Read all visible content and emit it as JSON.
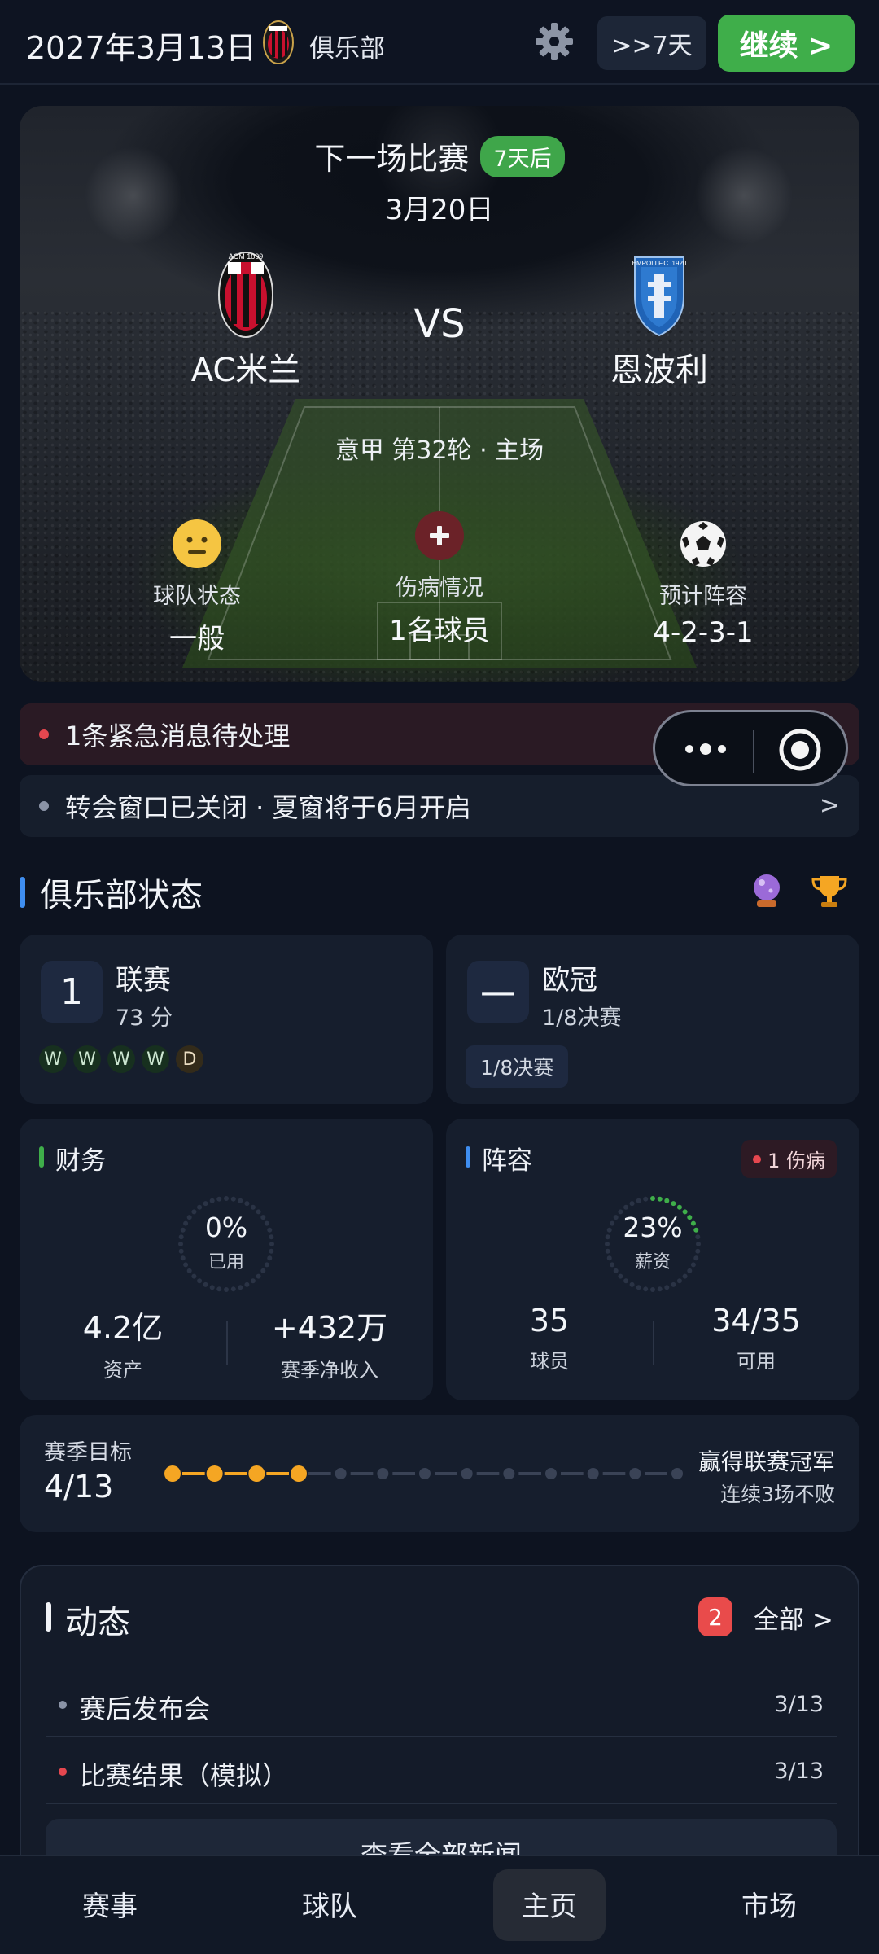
{
  "topbar": {
    "date": "2027年3月13日",
    "club_label": "俱乐部",
    "skip_label": ">>7天",
    "continue_label": "继续 >"
  },
  "match": {
    "title": "下一场比赛",
    "countdown_badge": "7天后",
    "date": "3月20日",
    "home_team": "AC米兰",
    "away_team": "恩波利",
    "vs": "VS",
    "competition": "意甲 第32轮 · 主场",
    "stats": [
      {
        "label": "球队状态",
        "value": "一般",
        "icon": "neutral-face-icon"
      },
      {
        "label": "伤病情况",
        "value": "1名球员",
        "icon": "medical-cross-icon"
      },
      {
        "label": "预计阵容",
        "value": "4-2-3-1",
        "icon": "soccer-ball-icon"
      }
    ],
    "home_crest_text": "ACM 1899",
    "away_crest_text": "EMPOLI F.C. 1920"
  },
  "notices": {
    "urgent": "1条紧急消息待处理",
    "transfer": "转会窗口已关闭 · 夏窗将于6月开启",
    "arrow": ">"
  },
  "club_status": {
    "title": "俱乐部状态",
    "league": {
      "rank": "1",
      "title": "联赛",
      "points": "73 分",
      "form": [
        "W",
        "W",
        "W",
        "W",
        "D"
      ]
    },
    "cup": {
      "rank": "—",
      "title": "欧冠",
      "stage": "1/8决赛",
      "tag": "1/8决赛"
    },
    "finance": {
      "title": "财务",
      "ring_pct": "0%",
      "ring_label": "已用",
      "ring_fraction": 0,
      "assets_value": "4.2亿",
      "assets_label": "资产",
      "income_value": "+432万",
      "income_label": "赛季净收入"
    },
    "squad": {
      "title": "阵容",
      "injury_badge": "1 伤病",
      "ring_pct": "23%",
      "ring_label": "薪资",
      "ring_fraction": 0.23,
      "players_value": "35",
      "players_label": "球员",
      "available_value": "34/35",
      "available_label": "可用"
    },
    "season_goal": {
      "title": "赛季目标",
      "progress": "4/13",
      "completed": 4,
      "total": 13,
      "goal_name": "赢得联赛冠军",
      "goal_desc": "连续3场不败"
    }
  },
  "news": {
    "title": "动态",
    "unread_count": "2",
    "view_all": "全部 >",
    "items": [
      {
        "title": "赛后发布会",
        "date": "3/13",
        "dot_color": "#8a93a6"
      },
      {
        "title": "比赛结果（模拟）",
        "date": "3/13",
        "dot_color": "#e5474f"
      }
    ],
    "more_label": "查看全部新闻"
  },
  "bottom_nav": [
    "赛事",
    "球队",
    "主页",
    "市场"
  ],
  "colors": {
    "accent_green": "#3fae4a",
    "accent_blue": "#3f8ef0",
    "urgent_red": "#e5474f",
    "goal_orange": "#f5a623"
  }
}
